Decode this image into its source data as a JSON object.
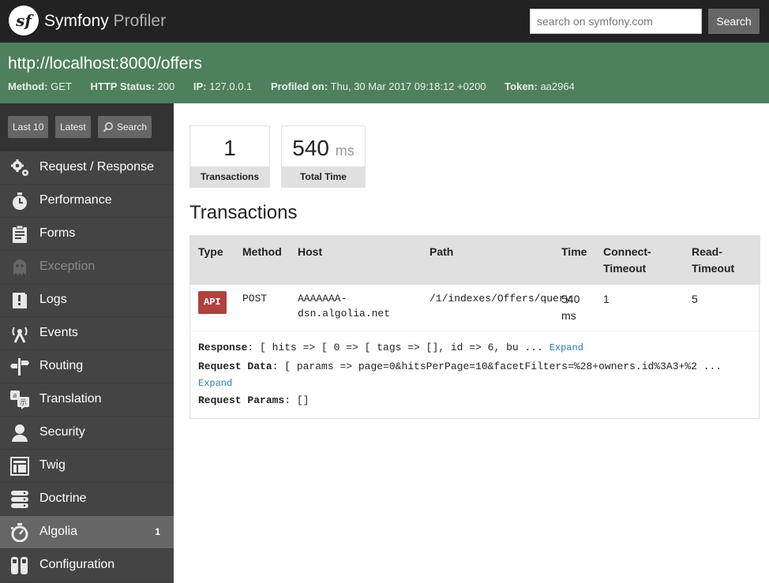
{
  "header": {
    "logo": "sf",
    "brand": "Symfony",
    "brand_sub": "Profiler",
    "search_placeholder": "search on symfony.com",
    "search_label": "Search"
  },
  "summary": {
    "url": "http://localhost:8000/offers",
    "method_label": "Method:",
    "method": "GET",
    "status_label": "HTTP Status:",
    "status": "200",
    "ip_label": "IP:",
    "ip": "127.0.0.1",
    "profiled_label": "Profiled on:",
    "profiled": "Thu, 30 Mar 2017 09:18:12 +0200",
    "token_label": "Token:",
    "token": "aa2964"
  },
  "sidebar": {
    "buttons": {
      "last10": "Last 10",
      "latest": "Latest",
      "search": "Search"
    },
    "items": [
      {
        "label": "Request / Response",
        "icon": "gears-icon"
      },
      {
        "label": "Performance",
        "icon": "stopwatch-icon"
      },
      {
        "label": "Forms",
        "icon": "clipboard-icon"
      },
      {
        "label": "Exception",
        "icon": "ghost-icon"
      },
      {
        "label": "Logs",
        "icon": "log-icon"
      },
      {
        "label": "Events",
        "icon": "antenna-icon"
      },
      {
        "label": "Routing",
        "icon": "signpost-icon"
      },
      {
        "label": "Translation",
        "icon": "translate-icon"
      },
      {
        "label": "Security",
        "icon": "user-icon"
      },
      {
        "label": "Twig",
        "icon": "template-icon"
      },
      {
        "label": "Doctrine",
        "icon": "database-icon"
      },
      {
        "label": "Algolia",
        "icon": "timer-icon",
        "count": "1"
      },
      {
        "label": "Configuration",
        "icon": "toggles-icon"
      }
    ]
  },
  "metrics": {
    "transactions_value": "1",
    "transactions_label": "Transactions",
    "time_value": "540",
    "time_unit": "ms",
    "time_label": "Total Time"
  },
  "transactions": {
    "title": "Transactions",
    "columns": [
      "Type",
      "Method",
      "Host",
      "Path",
      "Time",
      "Connect-Timeout",
      "Read-Timeout"
    ],
    "row": {
      "type": "API",
      "method": "POST",
      "host": "AAAAAAA-dsn.algolia.net",
      "path": "/1/indexes/Offers/query",
      "time": "540 ms",
      "connect_timeout": "1",
      "read_timeout": "5"
    },
    "details": {
      "response_label": "Response",
      "response_value": ": [ hits => [ 0 => [ tags => [], id => 6, bu ... ",
      "request_data_label": "Request Data",
      "request_data_value": ": [ params => page=0&hitsPerPage=10&facetFilters=%28+owners.id%3A3+%2 ... ",
      "request_params_label": "Request Params",
      "request_params_value": ": []",
      "expand": "Expand"
    }
  },
  "colors": {
    "header_bg": "#222222",
    "summary_bg": "#4f805d",
    "sidebar_bg": "#444444",
    "selected_bg": "#666666",
    "badge_bg": "#b0413e",
    "link": "#2a7ab0"
  }
}
